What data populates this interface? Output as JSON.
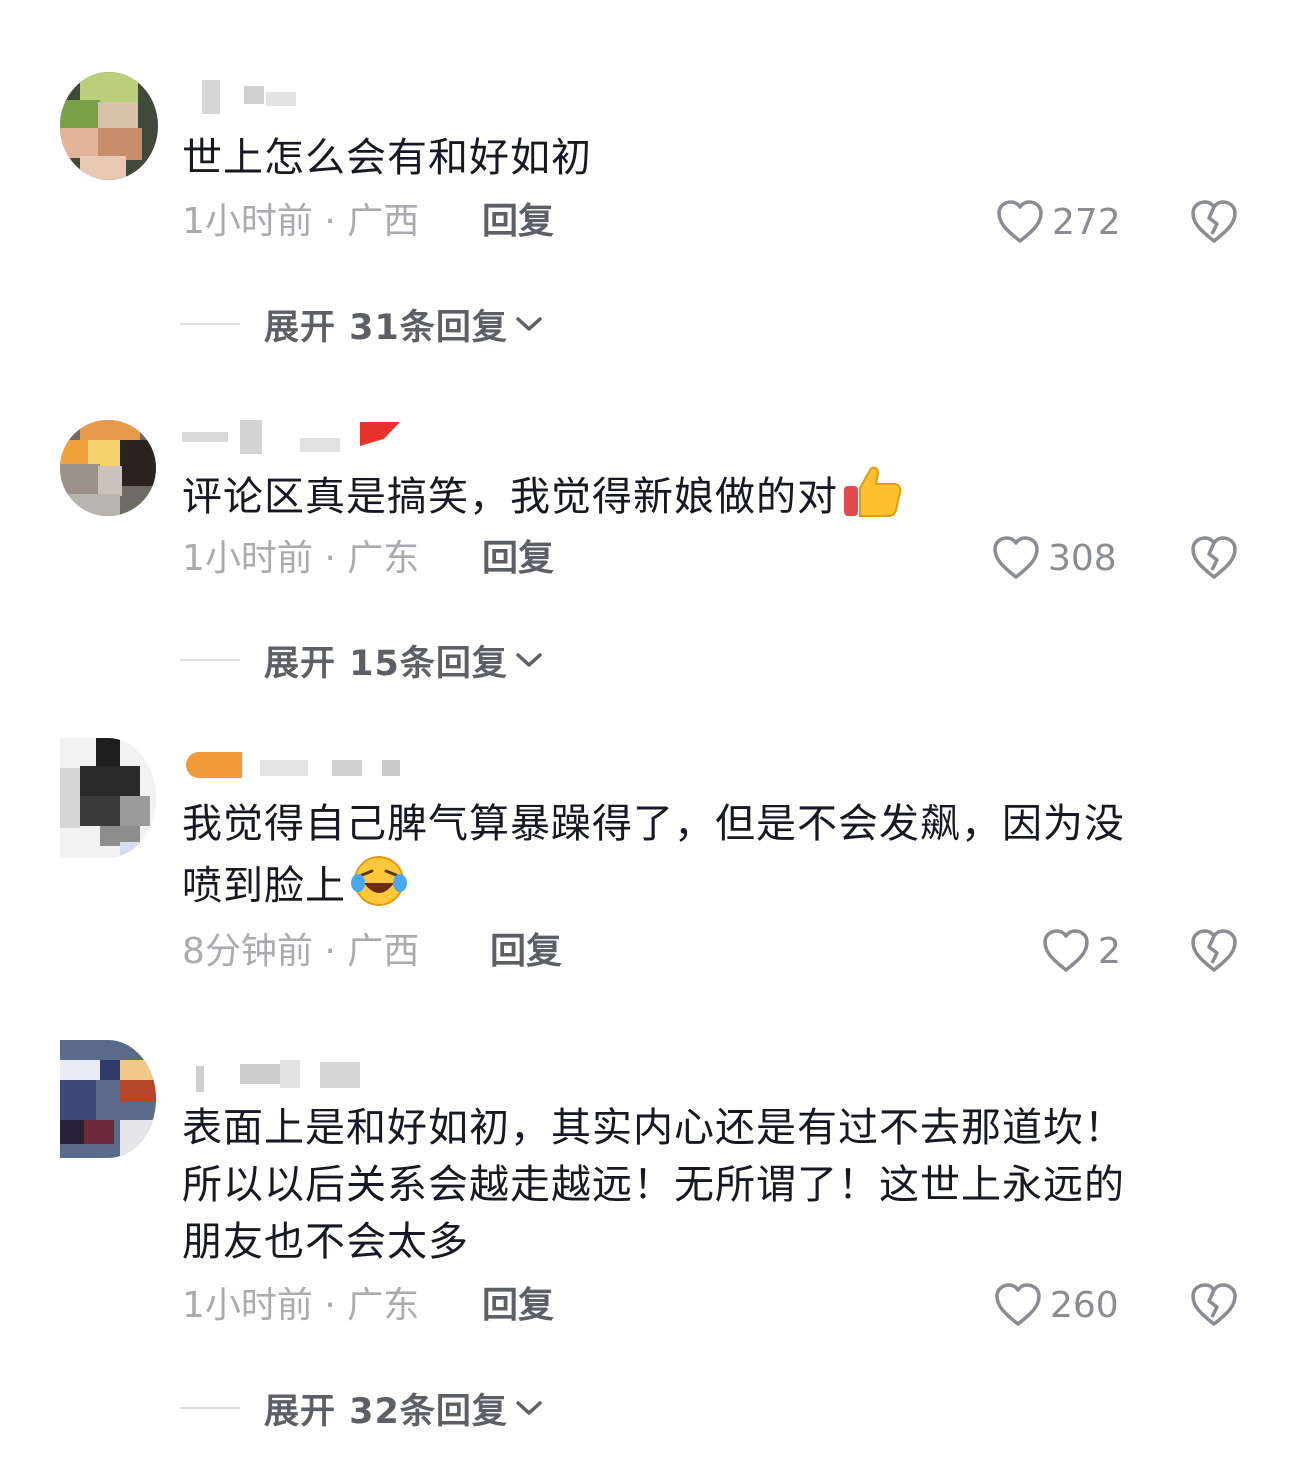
{
  "comments": [
    {
      "text": "世上怎么会有和好如初",
      "time_location": "1小时前 · 广西",
      "reply_label": "回复",
      "like_count": "272",
      "expand_label": "展开 31条回复"
    },
    {
      "text": "评论区真是搞笑，我觉得新娘做的对",
      "emoji": "thumbs-up-icon",
      "time_location": "1小时前 · 广东",
      "reply_label": "回复",
      "like_count": "308",
      "expand_label": "展开 15条回复"
    },
    {
      "text_line1": "我觉得自己脾气算暴躁得了，但是不会发飙，因为没",
      "text_line2": "喷到脸上",
      "emoji": "laughing-tears-icon",
      "time_location": "8分钟前 · 广西",
      "reply_label": "回复",
      "like_count": "2"
    },
    {
      "text_line1": "表面上是和好如初，其实内心还是有过不去那道坎！",
      "text_line2": "所以以后关系会越走越远！无所谓了！这世上永远的",
      "text_line3": "朋友也不会太多",
      "time_location": "1小时前 · 广东",
      "reply_label": "回复",
      "like_count": "260",
      "expand_label": "展开 32条回复"
    }
  ],
  "colors": {
    "text": "#161823",
    "meta": "#a9abb0",
    "secondary": "#5d5f66"
  }
}
